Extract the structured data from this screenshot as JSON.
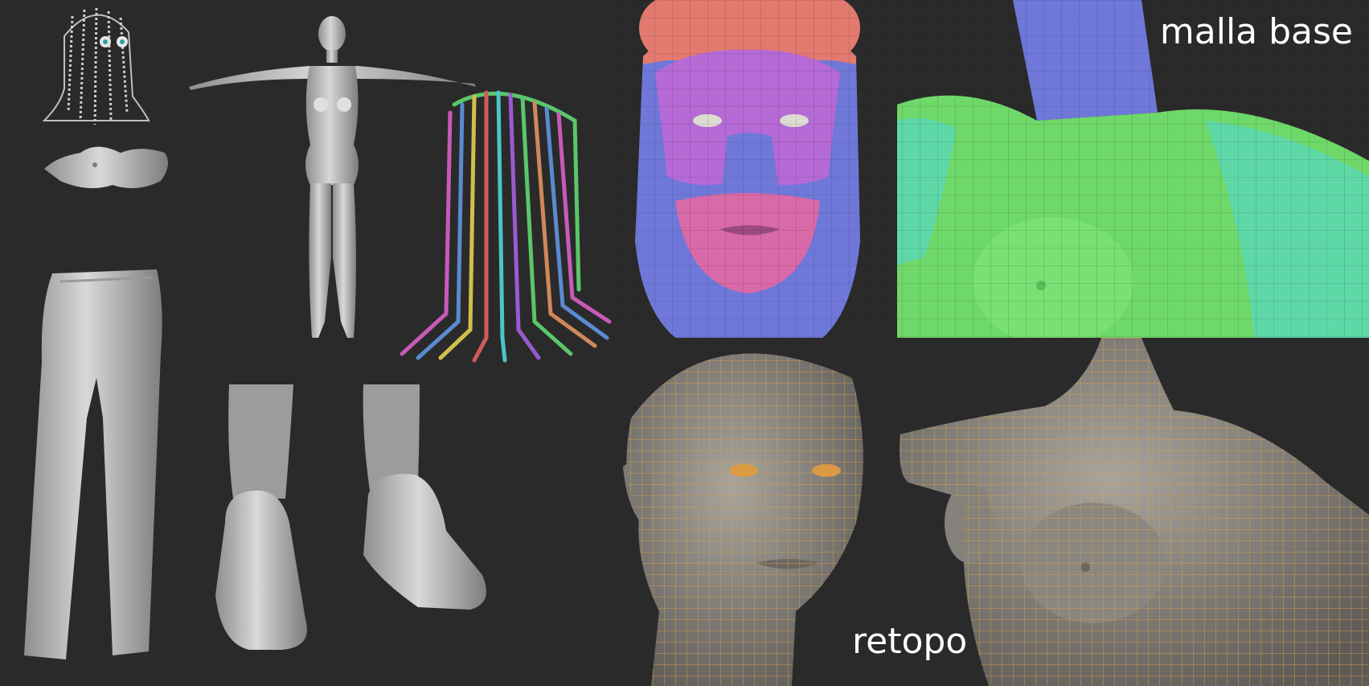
{
  "labels": {
    "base_mesh": "malla base",
    "retopology": "retopo"
  },
  "colors": {
    "background": "#2a2a2a",
    "clay": "#c9c9c9",
    "head_top": "#e27a70",
    "face_blue": "#6f78d8",
    "face_purple": "#b56ad6",
    "lips_pink": "#d86aa8",
    "torso_green": "#6fd86a",
    "arm_teal": "#5fd8a8",
    "retopo_skin": "#8d8a84",
    "retopo_wire": "#e0a240",
    "label_text": "#ffffff"
  },
  "icons": [
    "hair-guide-icon",
    "bra-model-icon",
    "t-pose-body-icon",
    "hair-strands-icon",
    "pants-model-icon",
    "left-shoe-icon",
    "right-shoe-icon"
  ]
}
